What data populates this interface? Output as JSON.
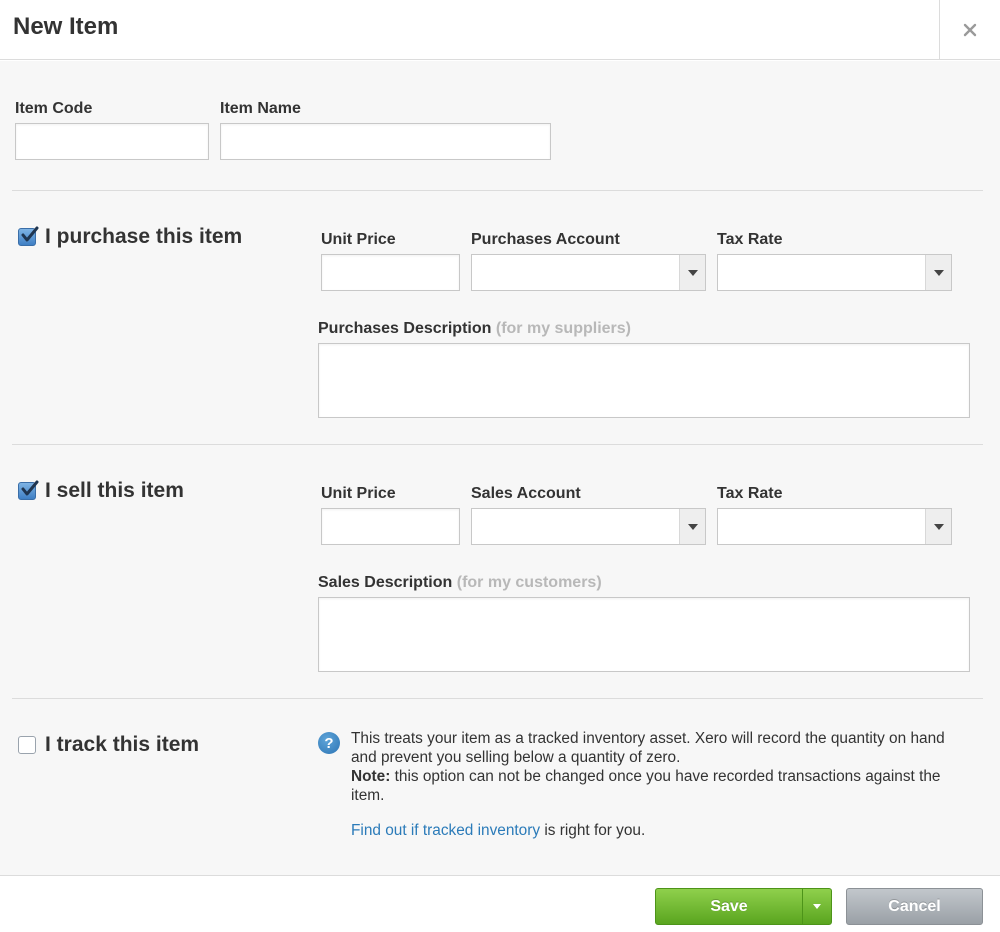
{
  "dialog": {
    "title": "New Item",
    "close_glyph": "×"
  },
  "item": {
    "code_label": "Item Code",
    "code_value": "",
    "name_label": "Item Name",
    "name_value": ""
  },
  "purchase": {
    "checked": true,
    "title": "I purchase this item",
    "unit_price_label": "Unit Price",
    "unit_price_value": "",
    "account_label": "Purchases Account",
    "account_value": "",
    "tax_label": "Tax Rate",
    "tax_value": "",
    "description_label": "Purchases Description",
    "description_hint": "(for my suppliers)",
    "description_value": ""
  },
  "sell": {
    "checked": true,
    "title": "I sell this item",
    "unit_price_label": "Unit Price",
    "unit_price_value": "",
    "account_label": "Sales Account",
    "account_value": "",
    "tax_label": "Tax Rate",
    "tax_value": "",
    "description_label": "Sales Description",
    "description_hint": "(for my customers)",
    "description_value": ""
  },
  "track": {
    "checked": false,
    "title": "I track this item",
    "help_glyph": "?",
    "info_text": "This treats your item as a tracked inventory asset. Xero will record the quantity on hand and prevent you selling below a quantity of zero.",
    "note_label": "Note:",
    "note_text": " this option can not be changed once you have recorded transactions against the item.",
    "link_text": "Find out if tracked inventory",
    "link_suffix": " is right for you."
  },
  "footer": {
    "save_label": "Save",
    "cancel_label": "Cancel"
  },
  "colors": {
    "save_green": "#6cb52e",
    "link_blue": "#2b7bb9",
    "checkbox_blue": "#4a86c8"
  }
}
